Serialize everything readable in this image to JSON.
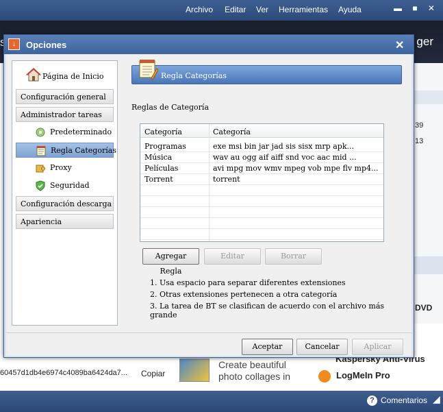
{
  "background": {
    "menubar": [
      "Archivo",
      "Editar",
      "Ver",
      "Herramientas",
      "Ayuda"
    ],
    "window_controls": "▬ ■ ✕",
    "logo_right": "ger",
    "logo_left": "s",
    "right_numbers": [
      "39",
      "13"
    ],
    "right_text": "DVD",
    "hash": "60457d1db4e6974c4089ba6424da7...",
    "copy_label": "Copiar",
    "ad1_lines": [
      "Create beautiful",
      "photo collages in"
    ],
    "ad2": "Kaspersky Anti-Virus",
    "ad3": "LogMeIn Pro",
    "status_link": "Comentarios"
  },
  "dialog": {
    "title": "Opciones",
    "close": "✕",
    "nav": {
      "home": "Página de Inicio",
      "general": "Configuración general",
      "tasks": "Administrador tareas",
      "default": "Predeterminado",
      "category_rule": "Regla Categorías",
      "proxy": "Proxy",
      "security": "Seguridad",
      "downloads": "Configuración descarga",
      "appearance": "Apariencia"
    },
    "panel_title": "Regla Categorías",
    "section_label": "Reglas de Categoría",
    "table": {
      "headers": [
        "Categoría",
        "Categoría"
      ],
      "rows": [
        [
          "Programas",
          "exe msi bin jar jad sis sisx mrp apk..."
        ],
        [
          "Música",
          "wav au ogg aif aiff snd voc aac mid ..."
        ],
        [
          "Películas",
          "avi mpg mov wmv mpeg vob mpe flv mp4..."
        ],
        [
          "Torrent",
          "torrent"
        ]
      ]
    },
    "buttons": {
      "add": "Agregar Regla",
      "edit": "Editar",
      "delete": "Borrar"
    },
    "notes": [
      "1. Usa espacio para separar diferentes extensiones",
      "2. Otras extensiones pertenecen a otra categoría",
      "3. La tarea de BT se clasifican de acuerdo con el archivo más grande"
    ],
    "footer": {
      "accept": "Aceptar",
      "cancel": "Cancelar",
      "apply": "Aplicar"
    }
  }
}
